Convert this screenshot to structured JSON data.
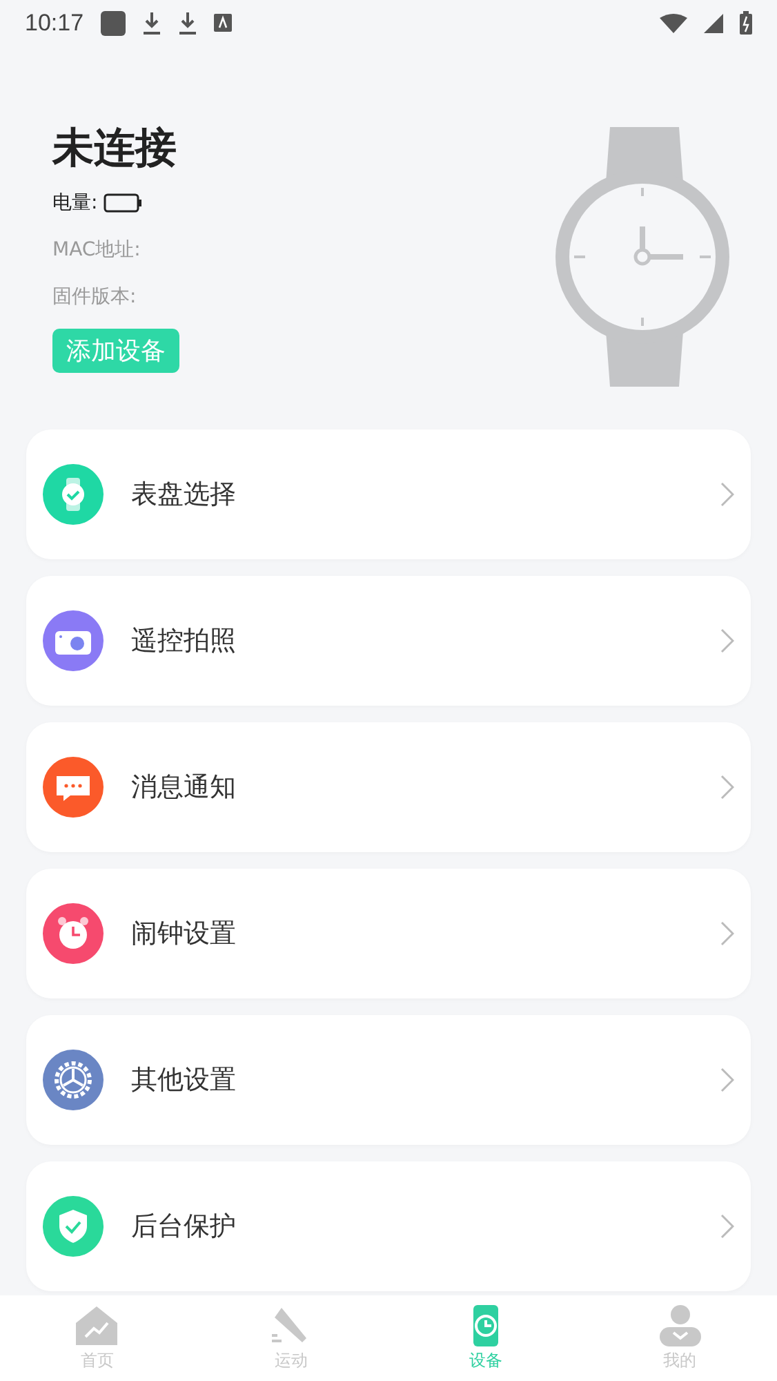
{
  "status_bar": {
    "time": "10:17"
  },
  "device": {
    "status": "未连接",
    "battery_label": "电量:",
    "mac_label": "MAC地址:",
    "firmware_label": "固件版本:",
    "add_button": "添加设备"
  },
  "menu": [
    {
      "kind": "watch",
      "label": "表盘选择",
      "color": "#1fd8a4"
    },
    {
      "kind": "camera",
      "label": "遥控拍照",
      "color": "#8a7af5"
    },
    {
      "kind": "message",
      "label": "消息通知",
      "color": "#fb5a2a"
    },
    {
      "kind": "alarm",
      "label": "闹钟设置",
      "color": "#f64a6e"
    },
    {
      "kind": "gear",
      "label": "其他设置",
      "color": "#6a86c4"
    },
    {
      "kind": "shield",
      "label": "后台保护",
      "color": "#2ad99a"
    }
  ],
  "tabs": [
    {
      "kind": "home",
      "label": "首页",
      "selected": false
    },
    {
      "kind": "sport",
      "label": "运动",
      "selected": false
    },
    {
      "kind": "device",
      "label": "设备",
      "selected": true
    },
    {
      "kind": "me",
      "label": "我的",
      "selected": false
    }
  ]
}
